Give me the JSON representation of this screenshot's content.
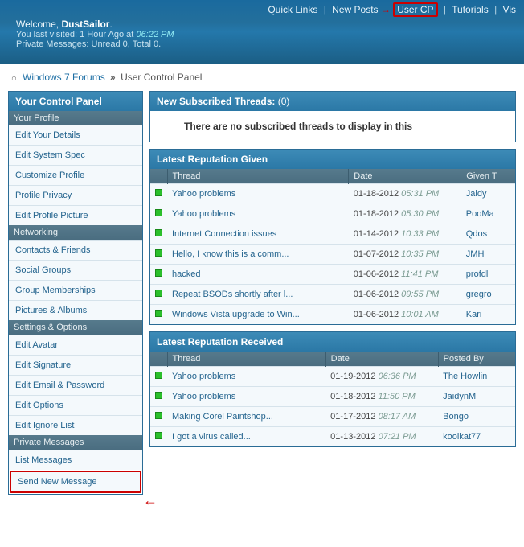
{
  "header": {
    "quicklinks": [
      "Quick Links",
      "New Posts",
      "User CP",
      "Tutorials",
      "Vis"
    ],
    "welcome_prefix": "Welcome, ",
    "username": "DustSailor",
    "welcome_suffix": ".",
    "lastvisit": "You last visited: 1 Hour Ago at ",
    "lastvisit_time": "06:22 PM",
    "pm_line": "Private Messages: Unread 0, Total 0."
  },
  "breadcrumb": {
    "home_glyph": "⌂",
    "link": "Windows 7 Forums",
    "current": "User Control Panel"
  },
  "sidebar": {
    "title": "Your Control Panel",
    "sections": [
      {
        "label": "Your Profile",
        "items": [
          "Edit Your Details",
          "Edit System Spec",
          "Customize Profile",
          "Profile Privacy",
          "Edit Profile Picture"
        ]
      },
      {
        "label": "Networking",
        "items": [
          "Contacts & Friends",
          "Social Groups",
          "Group Memberships",
          "Pictures & Albums"
        ]
      },
      {
        "label": "Settings & Options",
        "items": [
          "Edit Avatar",
          "Edit Signature",
          "Edit Email & Password",
          "Edit Options",
          "Edit Ignore List"
        ]
      },
      {
        "label": "Private Messages",
        "items": [
          "List Messages",
          "Send New Message"
        ]
      }
    ]
  },
  "subscribed": {
    "title_prefix": "New Subscribed Threads:",
    "count": "(0)",
    "empty": "There are no subscribed threads to display in this"
  },
  "rep_given": {
    "title": "Latest Reputation Given",
    "cols": [
      "",
      "Thread",
      "Date",
      "Given T"
    ],
    "rows": [
      {
        "thread": "Yahoo problems",
        "date": "01-18-2012",
        "time": "05:31 PM",
        "by": "Jaidy"
      },
      {
        "thread": "Yahoo problems",
        "date": "01-18-2012",
        "time": "05:30 PM",
        "by": "PooMa"
      },
      {
        "thread": "Internet Connection issues",
        "date": "01-14-2012",
        "time": "10:33 PM",
        "by": "Qdos"
      },
      {
        "thread": "Hello, I know this is a comm...",
        "date": "01-07-2012",
        "time": "10:35 PM",
        "by": "JMH"
      },
      {
        "thread": "hacked",
        "date": "01-06-2012",
        "time": "11:41 PM",
        "by": "profdl"
      },
      {
        "thread": "Repeat BSODs shortly after l...",
        "date": "01-06-2012",
        "time": "09:55 PM",
        "by": "gregro"
      },
      {
        "thread": "Windows Vista upgrade to Win...",
        "date": "01-06-2012",
        "time": "10:01 AM",
        "by": "Kari"
      }
    ]
  },
  "rep_recv": {
    "title": "Latest Reputation Received",
    "cols": [
      "",
      "Thread",
      "Date",
      "Posted By"
    ],
    "rows": [
      {
        "thread": "Yahoo problems",
        "date": "01-19-2012",
        "time": "06:36 PM",
        "by": "The Howlin"
      },
      {
        "thread": "Yahoo problems",
        "date": "01-18-2012",
        "time": "11:50 PM",
        "by": "JaidynM"
      },
      {
        "thread": "Making Corel Paintshop...",
        "date": "01-17-2012",
        "time": "08:17 AM",
        "by": "Bongo"
      },
      {
        "thread": "I got a virus called...",
        "date": "01-13-2012",
        "time": "07:21 PM",
        "by": "koolkat77"
      }
    ]
  }
}
